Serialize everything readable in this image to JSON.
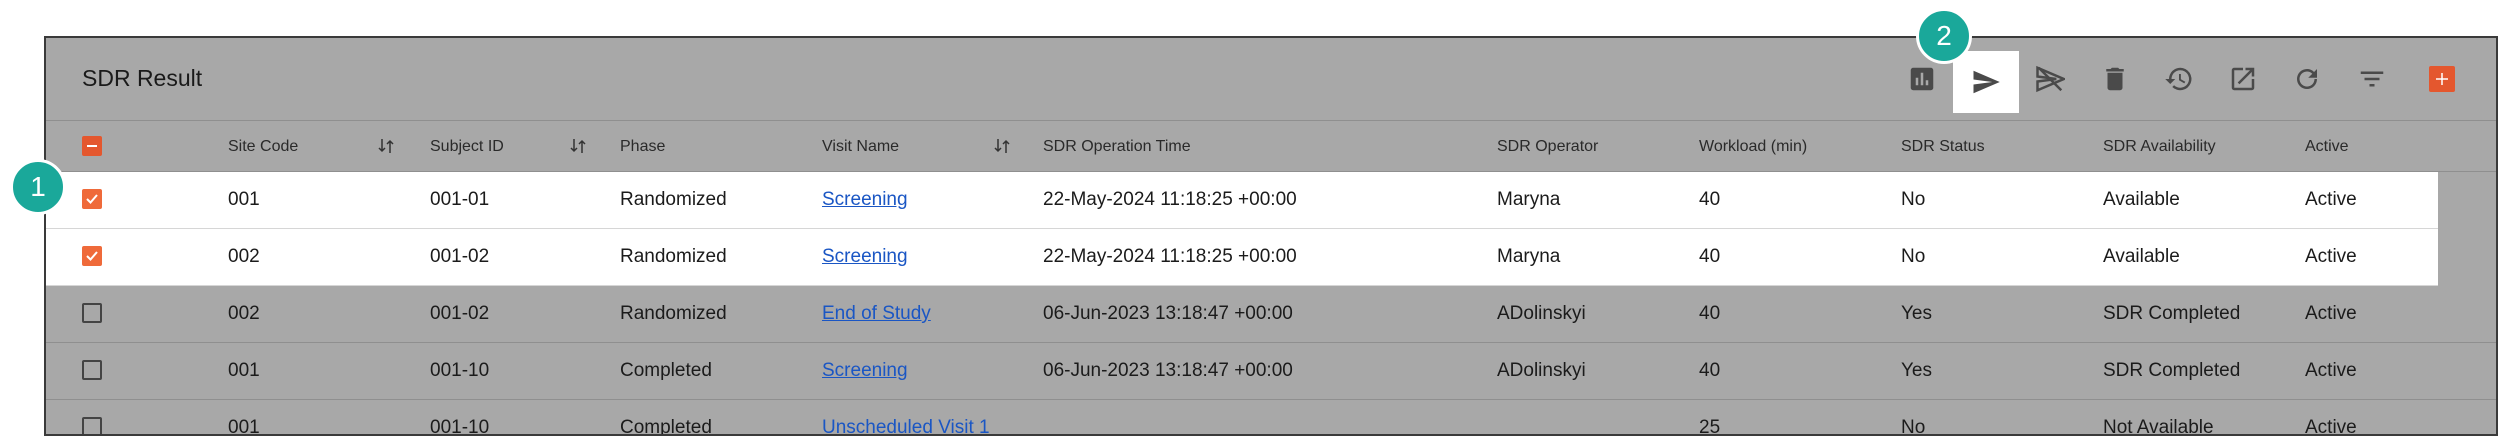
{
  "title": "SDR Result",
  "badges": [
    "1",
    "2"
  ],
  "columns": {
    "site_code": "Site Code",
    "subject_id": "Subject ID",
    "phase": "Phase",
    "visit_name": "Visit Name",
    "op_time": "SDR Operation Time",
    "operator": "SDR Operator",
    "workload": "Workload (min)",
    "status": "SDR Status",
    "availability": "SDR Availability",
    "active": "Active"
  },
  "rows": [
    {
      "site": "001",
      "subject": "001-01",
      "phase": "Randomized",
      "visit": "Screening",
      "time": "22-May-2024 11:18:25 +00:00",
      "operator": "Maryna",
      "workload": "40",
      "status": "No",
      "availability": "Available",
      "active": "Active"
    },
    {
      "site": "002",
      "subject": "001-02",
      "phase": "Randomized",
      "visit": "Screening",
      "time": "22-May-2024 11:18:25 +00:00",
      "operator": "Maryna",
      "workload": "40",
      "status": "No",
      "availability": "Available",
      "active": "Active"
    },
    {
      "site": "002",
      "subject": "001-02",
      "phase": "Randomized",
      "visit": "End of Study",
      "time": "06-Jun-2023 13:18:47 +00:00",
      "operator": "ADolinskyi",
      "workload": "40",
      "status": "Yes",
      "availability": "SDR Completed",
      "active": "Active"
    },
    {
      "site": "001",
      "subject": "001-10",
      "phase": "Completed",
      "visit": "Screening",
      "time": "06-Jun-2023 13:18:47 +00:00",
      "operator": "ADolinskyi",
      "workload": "40",
      "status": "Yes",
      "availability": "SDR Completed",
      "active": "Active"
    },
    {
      "site": "001",
      "subject": "001-10",
      "phase": "Completed",
      "visit": "Unscheduled Visit 1",
      "time": "",
      "operator": "",
      "workload": "25",
      "status": "No",
      "availability": "Not Available",
      "active": "Active"
    }
  ],
  "toolbar_icons": [
    "chart-icon",
    "send-icon",
    "unsend-icon",
    "delete-icon",
    "history-icon",
    "open-external-icon",
    "refresh-icon",
    "filter-icon",
    "add-icon"
  ],
  "colors": {
    "accent": "#e4572e",
    "badge": "#1aa89a",
    "link": "#1a56c4"
  }
}
